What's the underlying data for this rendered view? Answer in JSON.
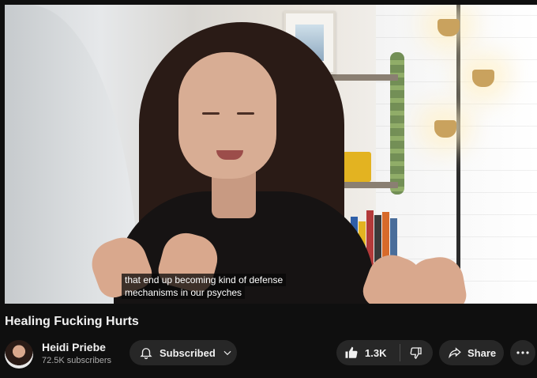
{
  "video": {
    "title": "Healing Fucking Hurts",
    "captions": [
      "that end up becoming kind of defense",
      "mechanisms in our psyches"
    ]
  },
  "channel": {
    "name": "Heidi Priebe",
    "subscribers": "72.5K subscribers"
  },
  "actions": {
    "subscribe_label": "Subscribed",
    "like_count": "1.3K",
    "share_label": "Share"
  },
  "icons": {
    "bell": "bell-icon",
    "chevron": "chevron-down-icon",
    "like": "thumbs-up-icon",
    "dislike": "thumbs-down-icon",
    "share": "share-arrow-icon",
    "more": "more-horizontal-icon"
  },
  "colors": {
    "background": "#0f0f0f",
    "button": "#272727",
    "text": "#f1f1f1",
    "secondary_text": "#aaaaaa"
  }
}
